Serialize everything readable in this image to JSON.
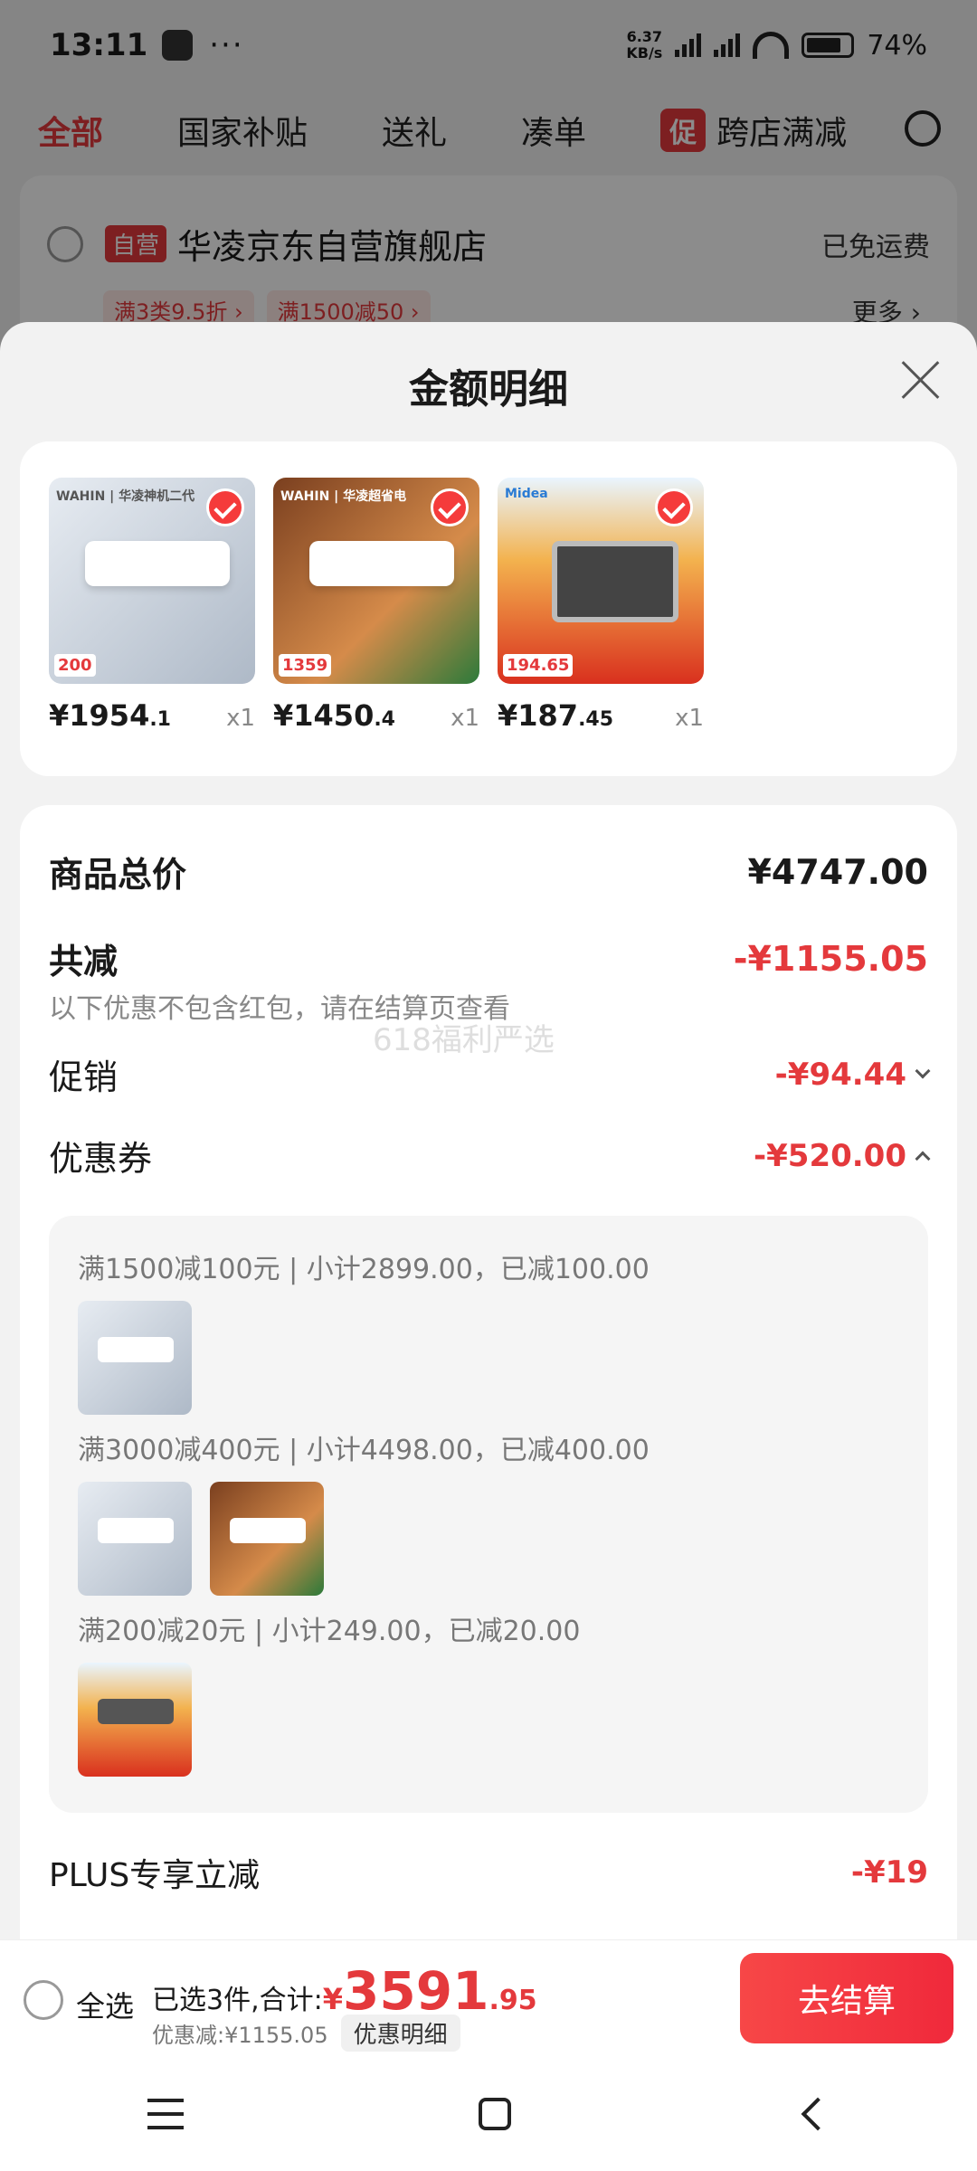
{
  "status": {
    "time": "13:11",
    "dots": "···",
    "speed_top": "6.37",
    "speed_bottom": "KB/s",
    "battery": "74%"
  },
  "tabs": [
    {
      "label": "全部",
      "active": true
    },
    {
      "label": "国家补贴"
    },
    {
      "label": "送礼"
    },
    {
      "label": "凑单"
    },
    {
      "label": "跨店满减",
      "promo": "促"
    }
  ],
  "store": {
    "self_tag": "自营",
    "name": "华凌京东自营旗舰店",
    "free_shipping": "已免运费",
    "promos": [
      "满3类9.5折 ›",
      "满1500减50 ›"
    ],
    "more": "更多 ›"
  },
  "sheet": {
    "title": "金额明细",
    "products": [
      {
        "brand": "WAHIN | 华凌神机二代",
        "price_main": "¥1954",
        "price_dec": ".1",
        "qty": "x1",
        "badge": "200"
      },
      {
        "brand": "WAHIN | 华凌超省电",
        "price_main": "¥1450",
        "price_dec": ".4",
        "qty": "x1",
        "badge": "1359"
      },
      {
        "brand": "Midea",
        "price_main": "¥187",
        "price_dec": ".45",
        "qty": "x1",
        "badge": "194.65"
      }
    ],
    "total_label": "商品总价",
    "total_value": "¥4747.00",
    "reduce_label": "共减",
    "reduce_value": "-¥1155.05",
    "reduce_note": "以下优惠不包含红包，请在结算页查看",
    "watermark": "618福利严选",
    "promo_label": "促销",
    "promo_value": "-¥94.44",
    "coupon_label": "优惠券",
    "coupon_value": "-¥520.00",
    "coupon_groups": [
      {
        "text": "满1500减100元 | 小计2899.00，已减100.00"
      },
      {
        "text": "满3000减400元 | 小计4498.00，已减400.00"
      },
      {
        "text": "满200减20元 | 小计249.00，已减20.00"
      }
    ],
    "plus_label": "PLUS专享立减",
    "plus_value": "-¥19"
  },
  "bottom": {
    "select_all": "全选",
    "selected_text": "已选3件,合计:",
    "currency": "¥",
    "total_big": "3591",
    "total_dec": ".95",
    "discount_text": "优惠减:¥1155.05",
    "detail_btn": "优惠明细",
    "checkout": "去结算"
  },
  "colors": {
    "accent": "#e4393c",
    "checkout": "#f0293b"
  }
}
